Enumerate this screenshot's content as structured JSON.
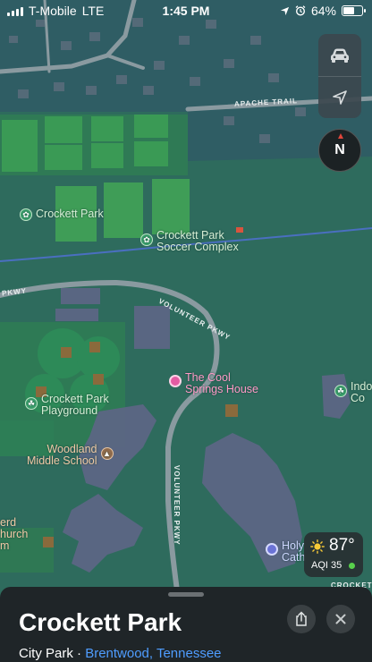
{
  "status": {
    "carrier": "T-Mobile",
    "network": "LTE",
    "time": "1:45 PM",
    "battery": "64%",
    "battery_level": 0.64
  },
  "map": {
    "controls": {
      "drive_icon": "car-icon",
      "location_icon": "location-arrow-icon"
    },
    "compass": {
      "letter": "N"
    },
    "pois": {
      "crockett_park": "Crockett Park",
      "soccer_complex": "Crockett Park\nSoccer Complex",
      "cool_springs_house": "The Cool\nSprings House",
      "playground": "Crockett Park\nPlayground",
      "woodland_school": "Woodland\nMiddle School",
      "indo": "Indo\nCo",
      "holy_cath": "Holy\nCath",
      "church_partial": "erd\nhurch\nm"
    },
    "streets": {
      "apache_trail": "APACHE TRAIL",
      "volunteer_pkwy_top": "VOLUNTEER PKWY",
      "volunteer_pkwy_left": "PKWY",
      "volunteer_pkwy_vertical": "VOLUNTEER PKWY",
      "crockett_partial": "CROCKETT"
    },
    "colors": {
      "park": "#3c8a5e",
      "residential": "#2d5f63",
      "building": "#5f6a86",
      "road": "#8a9a9e",
      "poi_pink": "#e45ca3",
      "poi_green": "#3a9d6b"
    }
  },
  "weather": {
    "temperature": "87°",
    "aqi": "AQI 35"
  },
  "sheet": {
    "title": "Crockett Park",
    "category": "City Park",
    "separator": " · ",
    "location": "Brentwood, Tennessee"
  }
}
